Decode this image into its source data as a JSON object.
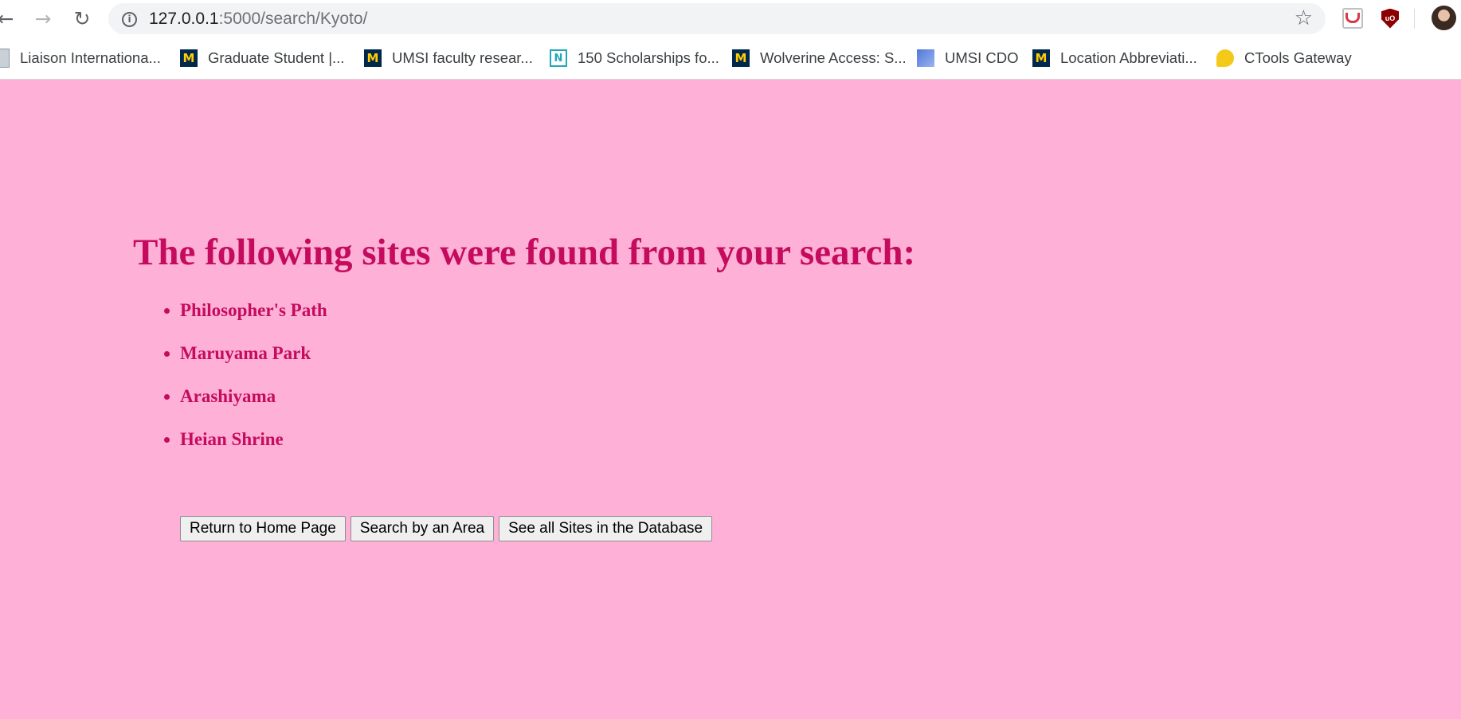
{
  "browser": {
    "url_host": "127.0.0.1",
    "url_path": ":5000/search/Kyoto/",
    "back_icon": "back-arrow-icon",
    "forward_icon": "forward-arrow-icon",
    "reload_icon": "reload-icon",
    "bookmarks": [
      {
        "label": "Liaison Internationa...",
        "icon": "liaison-favicon"
      },
      {
        "label": "Graduate Student |...",
        "icon": "umich-m-favicon"
      },
      {
        "label": "UMSI faculty resear...",
        "icon": "umich-m-favicon"
      },
      {
        "label": "150 Scholarships fo...",
        "icon": "n-favicon"
      },
      {
        "label": "Wolverine Access: S...",
        "icon": "umich-m-favicon"
      },
      {
        "label": "UMSI CDO",
        "icon": "blue-square-favicon"
      },
      {
        "label": "Location Abbreviati...",
        "icon": "umich-m-favicon"
      },
      {
        "label": "CTools Gateway",
        "icon": "chat-bubble-favicon"
      }
    ]
  },
  "page": {
    "background_color": "#ffb0d6",
    "text_color": "#c40b5e",
    "heading": "The following sites were found from your search:",
    "results": [
      "Philosopher's Path",
      "Maruyama Park",
      "Arashiyama",
      "Heian Shrine"
    ],
    "buttons": {
      "home": "Return to Home Page",
      "area": "Search by an Area",
      "all_sites": "See all Sites in the Database"
    }
  }
}
